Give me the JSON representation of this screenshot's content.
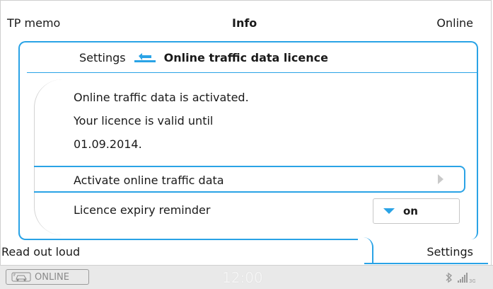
{
  "topbar": {
    "left": "TP memo",
    "center": "Info",
    "right": "Online"
  },
  "breadcrumb": {
    "parent": "Settings",
    "current": "Online traffic data licence"
  },
  "info_lines": [
    "Online traffic data is activated.",
    "Your licence is valid until",
    "01.09.2014."
  ],
  "rows": {
    "activate_label": "Activate online traffic data",
    "expiry_label": "Licence expiry reminder",
    "expiry_value": "on"
  },
  "bottom_tabs": {
    "left": "Read out loud",
    "right": "Settings"
  },
  "statusbar": {
    "online_badge": "ONLINE",
    "clock": "12:00",
    "network": "3G"
  },
  "colors": {
    "accent": "#2aa3e6"
  }
}
